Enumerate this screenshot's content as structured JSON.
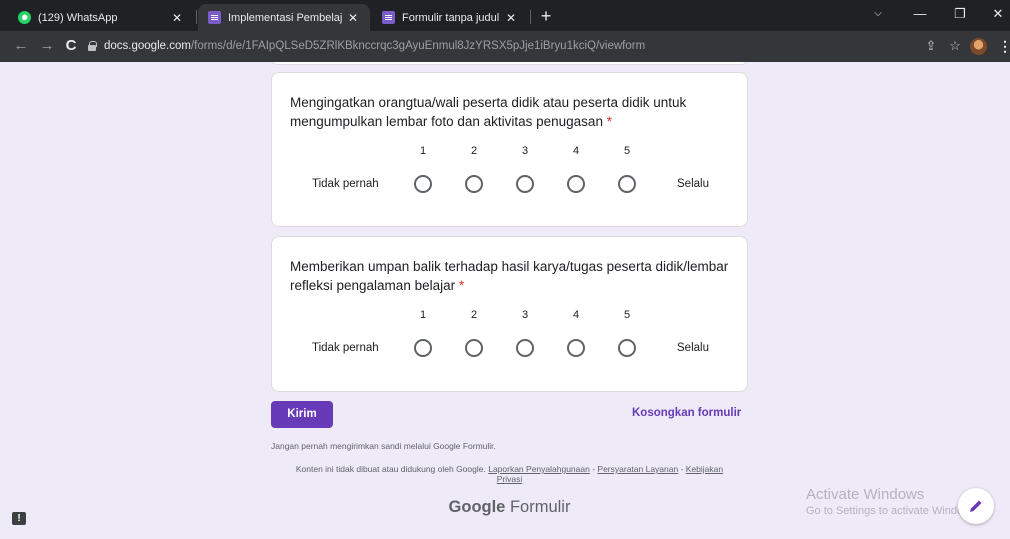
{
  "browser": {
    "tabs": [
      {
        "title": "(129) WhatsApp",
        "icon": "whatsapp-icon",
        "close": "✕"
      },
      {
        "title": "Implementasi Pembelajaran Jarak",
        "icon": "forms-icon",
        "close": "✕"
      },
      {
        "title": "Formulir tanpa judul - Google Fo",
        "icon": "forms-icon",
        "close": "✕"
      }
    ],
    "new_tab": "+",
    "url_host": "docs.google.com",
    "url_path": "/forms/d/e/1FAIpQLSeD5ZRlKBknccrqc3gAyuEnmul8JzYRSX5pJje1iBryu1kciQ/viewform",
    "controls": {
      "min": "—",
      "max": "❐",
      "close": "✕",
      "back": "←",
      "forward": "→",
      "reload": "C"
    }
  },
  "form": {
    "questions": [
      {
        "text": "Mengingatkan orangtua/wali peserta didik atau peserta didik untuk mengumpulkan lembar foto dan aktivitas penugasan",
        "required_mark": "*",
        "scale": [
          "1",
          "2",
          "3",
          "4",
          "5"
        ],
        "low_label": "Tidak pernah",
        "high_label": "Selalu"
      },
      {
        "text": "Memberikan umpan balik terhadap hasil karya/tugas peserta didik/lembar refleksi pengalaman belajar",
        "required_mark": "*",
        "scale": [
          "1",
          "2",
          "3",
          "4",
          "5"
        ],
        "low_label": "Tidak pernah",
        "high_label": "Selalu"
      }
    ],
    "submit_label": "Kirim",
    "clear_label": "Kosongkan formulir",
    "password_warning": "Jangan pernah mengirimkan sandi melalui Google Formulir.",
    "disclaimer_prefix": "Konten ini tidak dibuat atau didukung oleh Google.",
    "link_report": "Laporkan Penyalahgunaan",
    "sep": " - ",
    "link_terms": "Persyaratan Layanan",
    "link_privacy_1": "Kebijakan",
    "link_privacy_2": "Privasi",
    "brand_google": "Google",
    "brand_product": "Formulir"
  },
  "watermark": {
    "line1": "Activate Windows",
    "line2": "Go to Settings to activate Windows."
  },
  "colors": {
    "accent": "#673ab7",
    "required": "#d93025",
    "background": "#efeaf8"
  }
}
